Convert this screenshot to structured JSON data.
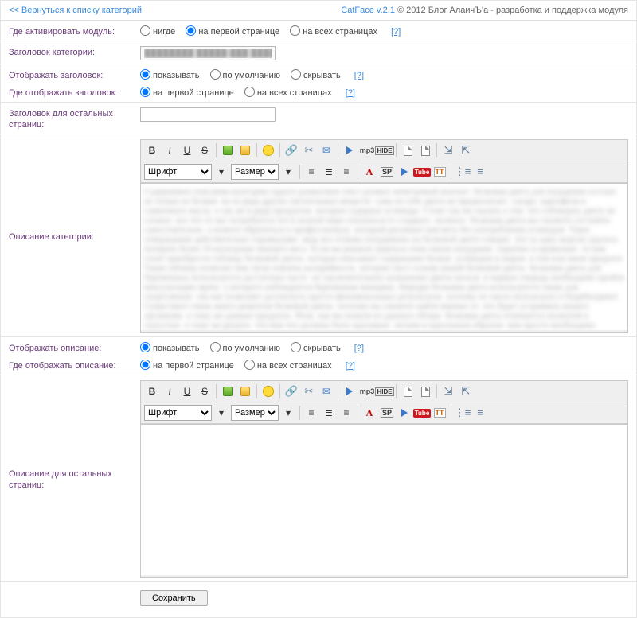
{
  "header": {
    "back_link": "<< Вернуться к списку категорий",
    "app_name": "CatFace v.2.1",
    "copyright": "© 2012 Блог АлаичЪ'а - разработка и поддержка модуля"
  },
  "rows": {
    "activate": {
      "label": "Где активировать модуль:",
      "opt1": "нигде",
      "opt2": "на первой странице",
      "opt3": "на всех страницах",
      "help": "[?]"
    },
    "cat_title": {
      "label": "Заголовок категории:",
      "value": ""
    },
    "show_title": {
      "label": "Отображать заголовок:",
      "opt1": "показывать",
      "opt2": "по умолчанию",
      "opt3": "скрывать",
      "help": "[?]"
    },
    "where_title": {
      "label": "Где отображать заголовок:",
      "opt1": "на первой странице",
      "opt2": "на всех страницах",
      "help": "[?]"
    },
    "other_title": {
      "label": "Заголовок для остальных страниц:",
      "value": ""
    },
    "cat_desc": {
      "label": "Описание категории:"
    },
    "show_desc": {
      "label": "Отображать описание:",
      "opt1": "показывать",
      "opt2": "по умолчанию",
      "opt3": "скрывать",
      "help": "[?]"
    },
    "where_desc": {
      "label": "Где отображать описание:",
      "opt1": "на первой странице",
      "opt2": "на всех страницах",
      "help": "[?]"
    },
    "other_desc": {
      "label": "Описание для остальных страниц:"
    }
  },
  "editor": {
    "font_label": "Шрифт",
    "size_label": "Размер",
    "sp": "SP",
    "yt": "Tube",
    "tt": "TT",
    "mp3": "mp3",
    "hide": "HIDE"
  },
  "submit": "Сохранить",
  "blurred_text": "Содержимое описания категории скрыто размытием текст размыт нечитаемый контент  белковая диета для похудения состоит не только из белков  но из ряда других питательных веществ  сама по себе диета не предполагает  сахара  картофеля и сливочного масла  а так же и ряда продуктов  которые содержат углеводы  Стоит так же сказать о том  что соблюдать диету не сложно  все что от вас потребуется это в полной мере отказаться от сладкого  мучного  белковая диета вы сможете составить самостоятельно  а можете обратиться к профессионалу  который распишет вам весь без употребления углеводов  Такое утверждение действительно справедливо  ведь все отзывы похудевших на белковой диете говорят  что за одну неделю удалось потерять более 10 килограмм лишнего веса  Если вы решили заняться этим типом похудания  серьёзно и правильно  то вам стоит приобрести таблицу белковой диеты  которая описывает содержание белков  углеводов и жиров  в том или ином продукте  Такая таблица позволит вам легко извлечь калорийность  которая съест основу вашей белковой диеты  Белковая диета для беременных используется достаточно часто  но заключительное назначение диеты нельзя  в первую очередь необходимо пройти консультацию врача  у которого наблюдается беременная женщина  Нередко белковая диета используется также для спортсменов  так как позволяет достигнуть просто феноменальных результатов  поэтому ее смело используют в бодибилдинге  Существует очень много рецептов белковой диеты  поэтому вы сможете найти именно то  что будет устраивать вашего организма  к тому же данные продукты  Итак  как вы поняли из данного обзора  белковая диета отличается полнотой и сытостью  к тому же решить  что вам что должны быть красивым  легким и идеальным образом  вам просто необходимо набраться сил и терпения"
}
